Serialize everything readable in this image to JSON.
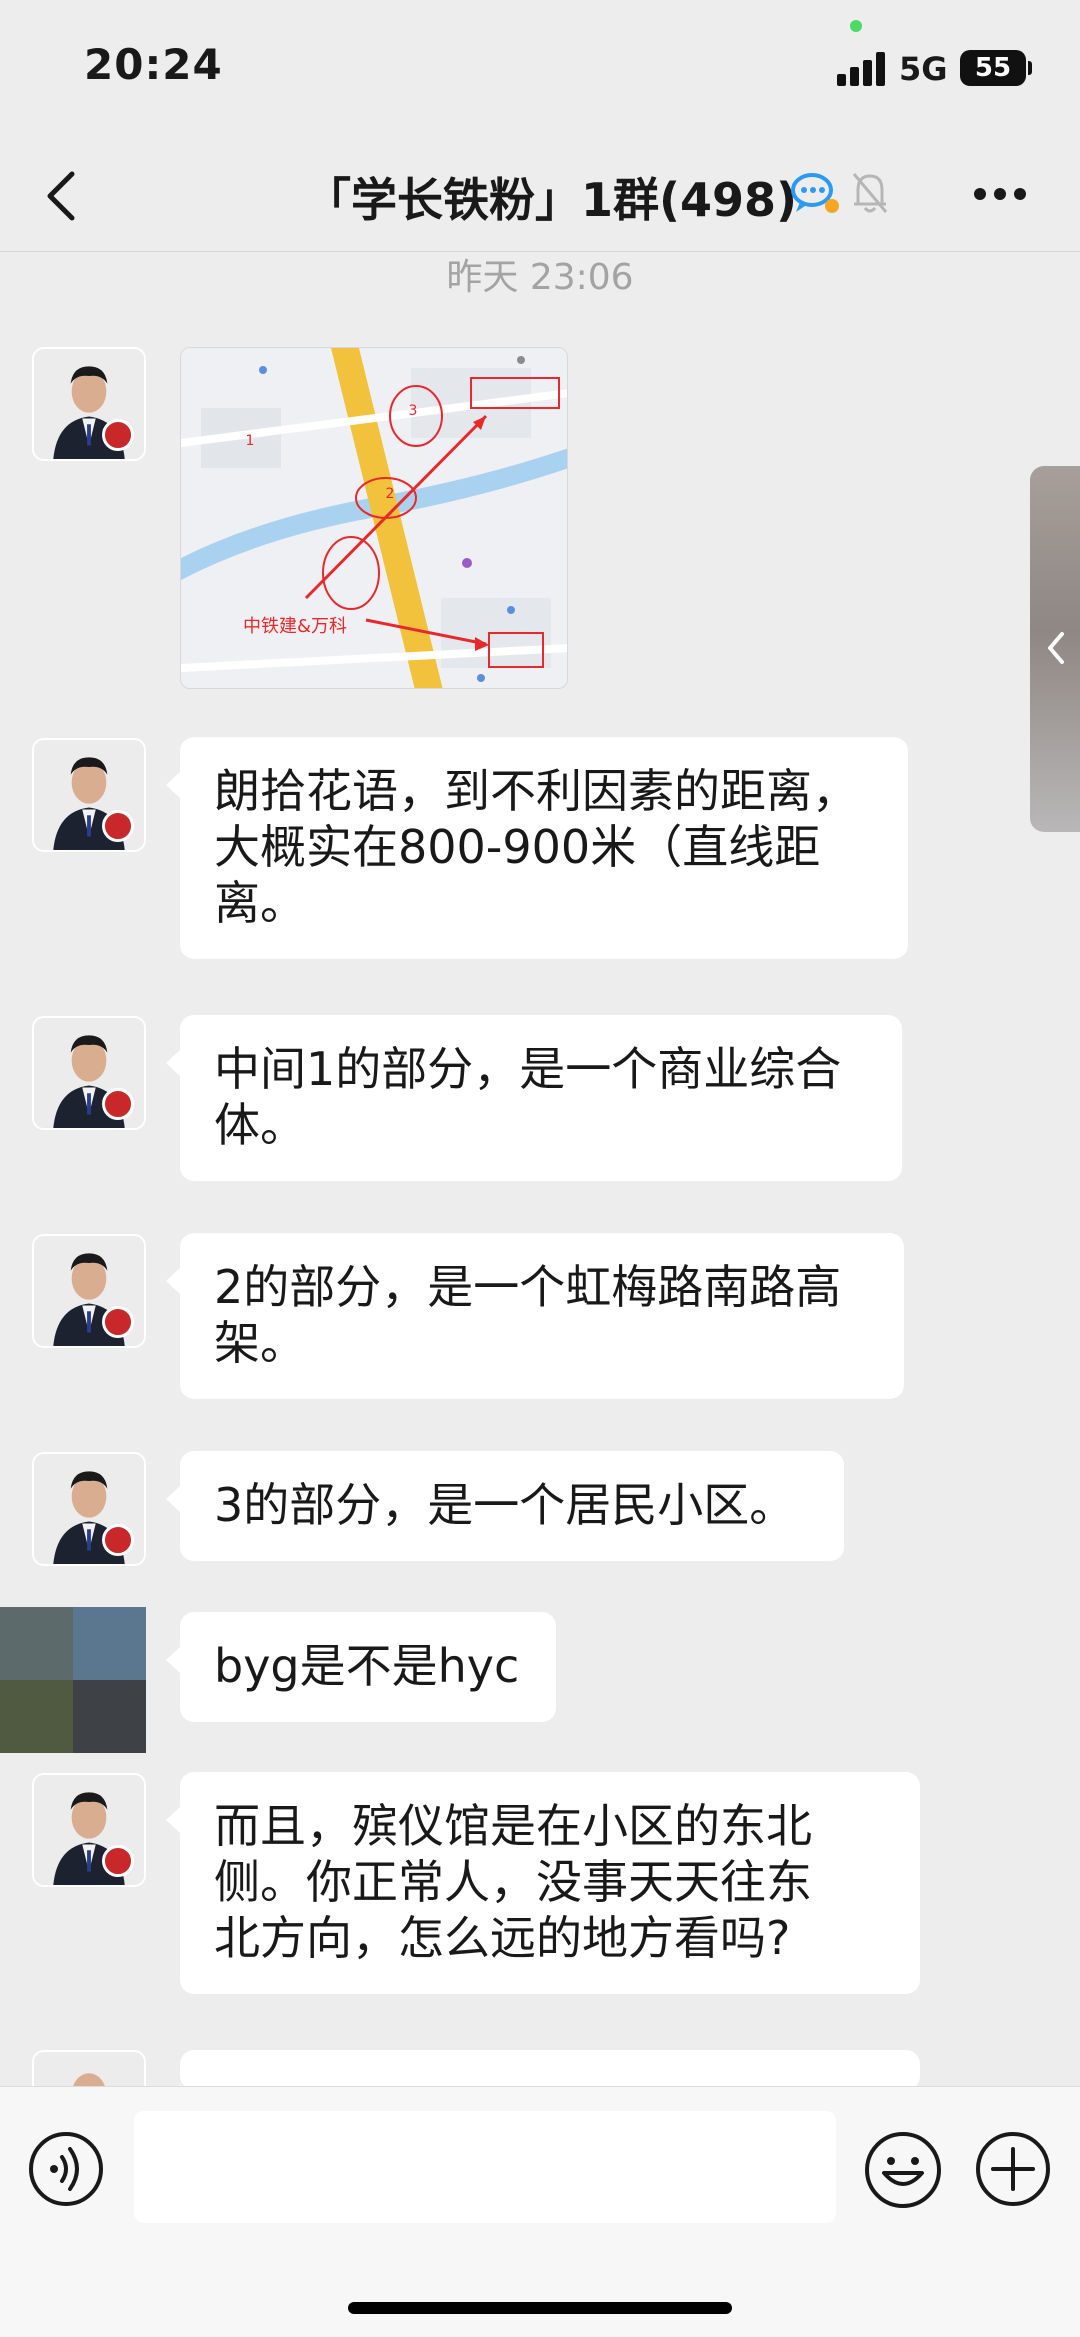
{
  "status_bar": {
    "time": "20:24",
    "network": "5G",
    "battery": "55"
  },
  "nav": {
    "title": "「学长铁粉」1群(498)"
  },
  "chat": {
    "timestamp": "昨天 23:06",
    "map_image": {
      "caption": "中铁建&万科",
      "marks": [
        "1",
        "2",
        "3"
      ]
    },
    "messages": [
      {
        "lines": [
          "朗拾花语，到不利因素的距离，",
          "大概实在800-900米（直线距",
          "离。"
        ]
      },
      {
        "lines": [
          "中间1的部分，是一个商业综合",
          "体。"
        ]
      },
      {
        "lines": [
          "2的部分，是一个虹梅路南路高",
          "架。"
        ]
      },
      {
        "lines": [
          "3的部分，是一个居民小区。"
        ]
      },
      {
        "lines": [
          "byg是不是hyc"
        ]
      },
      {
        "lines": [
          "而且，殡仪馆是在小区的东北",
          "侧。你正常人，没事天天往东",
          "北方向，怎么远的地方看吗?"
        ]
      }
    ]
  },
  "input": {
    "placeholder": ""
  },
  "icons": {
    "back": "chevron-left-icon",
    "group_chat": "chat-bubble-icon",
    "mute": "bell-muted-icon",
    "more": "more-dots-icon",
    "voice": "voice-icon",
    "emoji": "emoji-icon",
    "plus": "plus-icon",
    "side_handle": "chevron-left-icon"
  },
  "colors": {
    "background": "#ededed",
    "bubble": "#ffffff",
    "map_water": "#a9d2f0",
    "map_road": "#f2c23c",
    "annotation": "#e8282b"
  }
}
